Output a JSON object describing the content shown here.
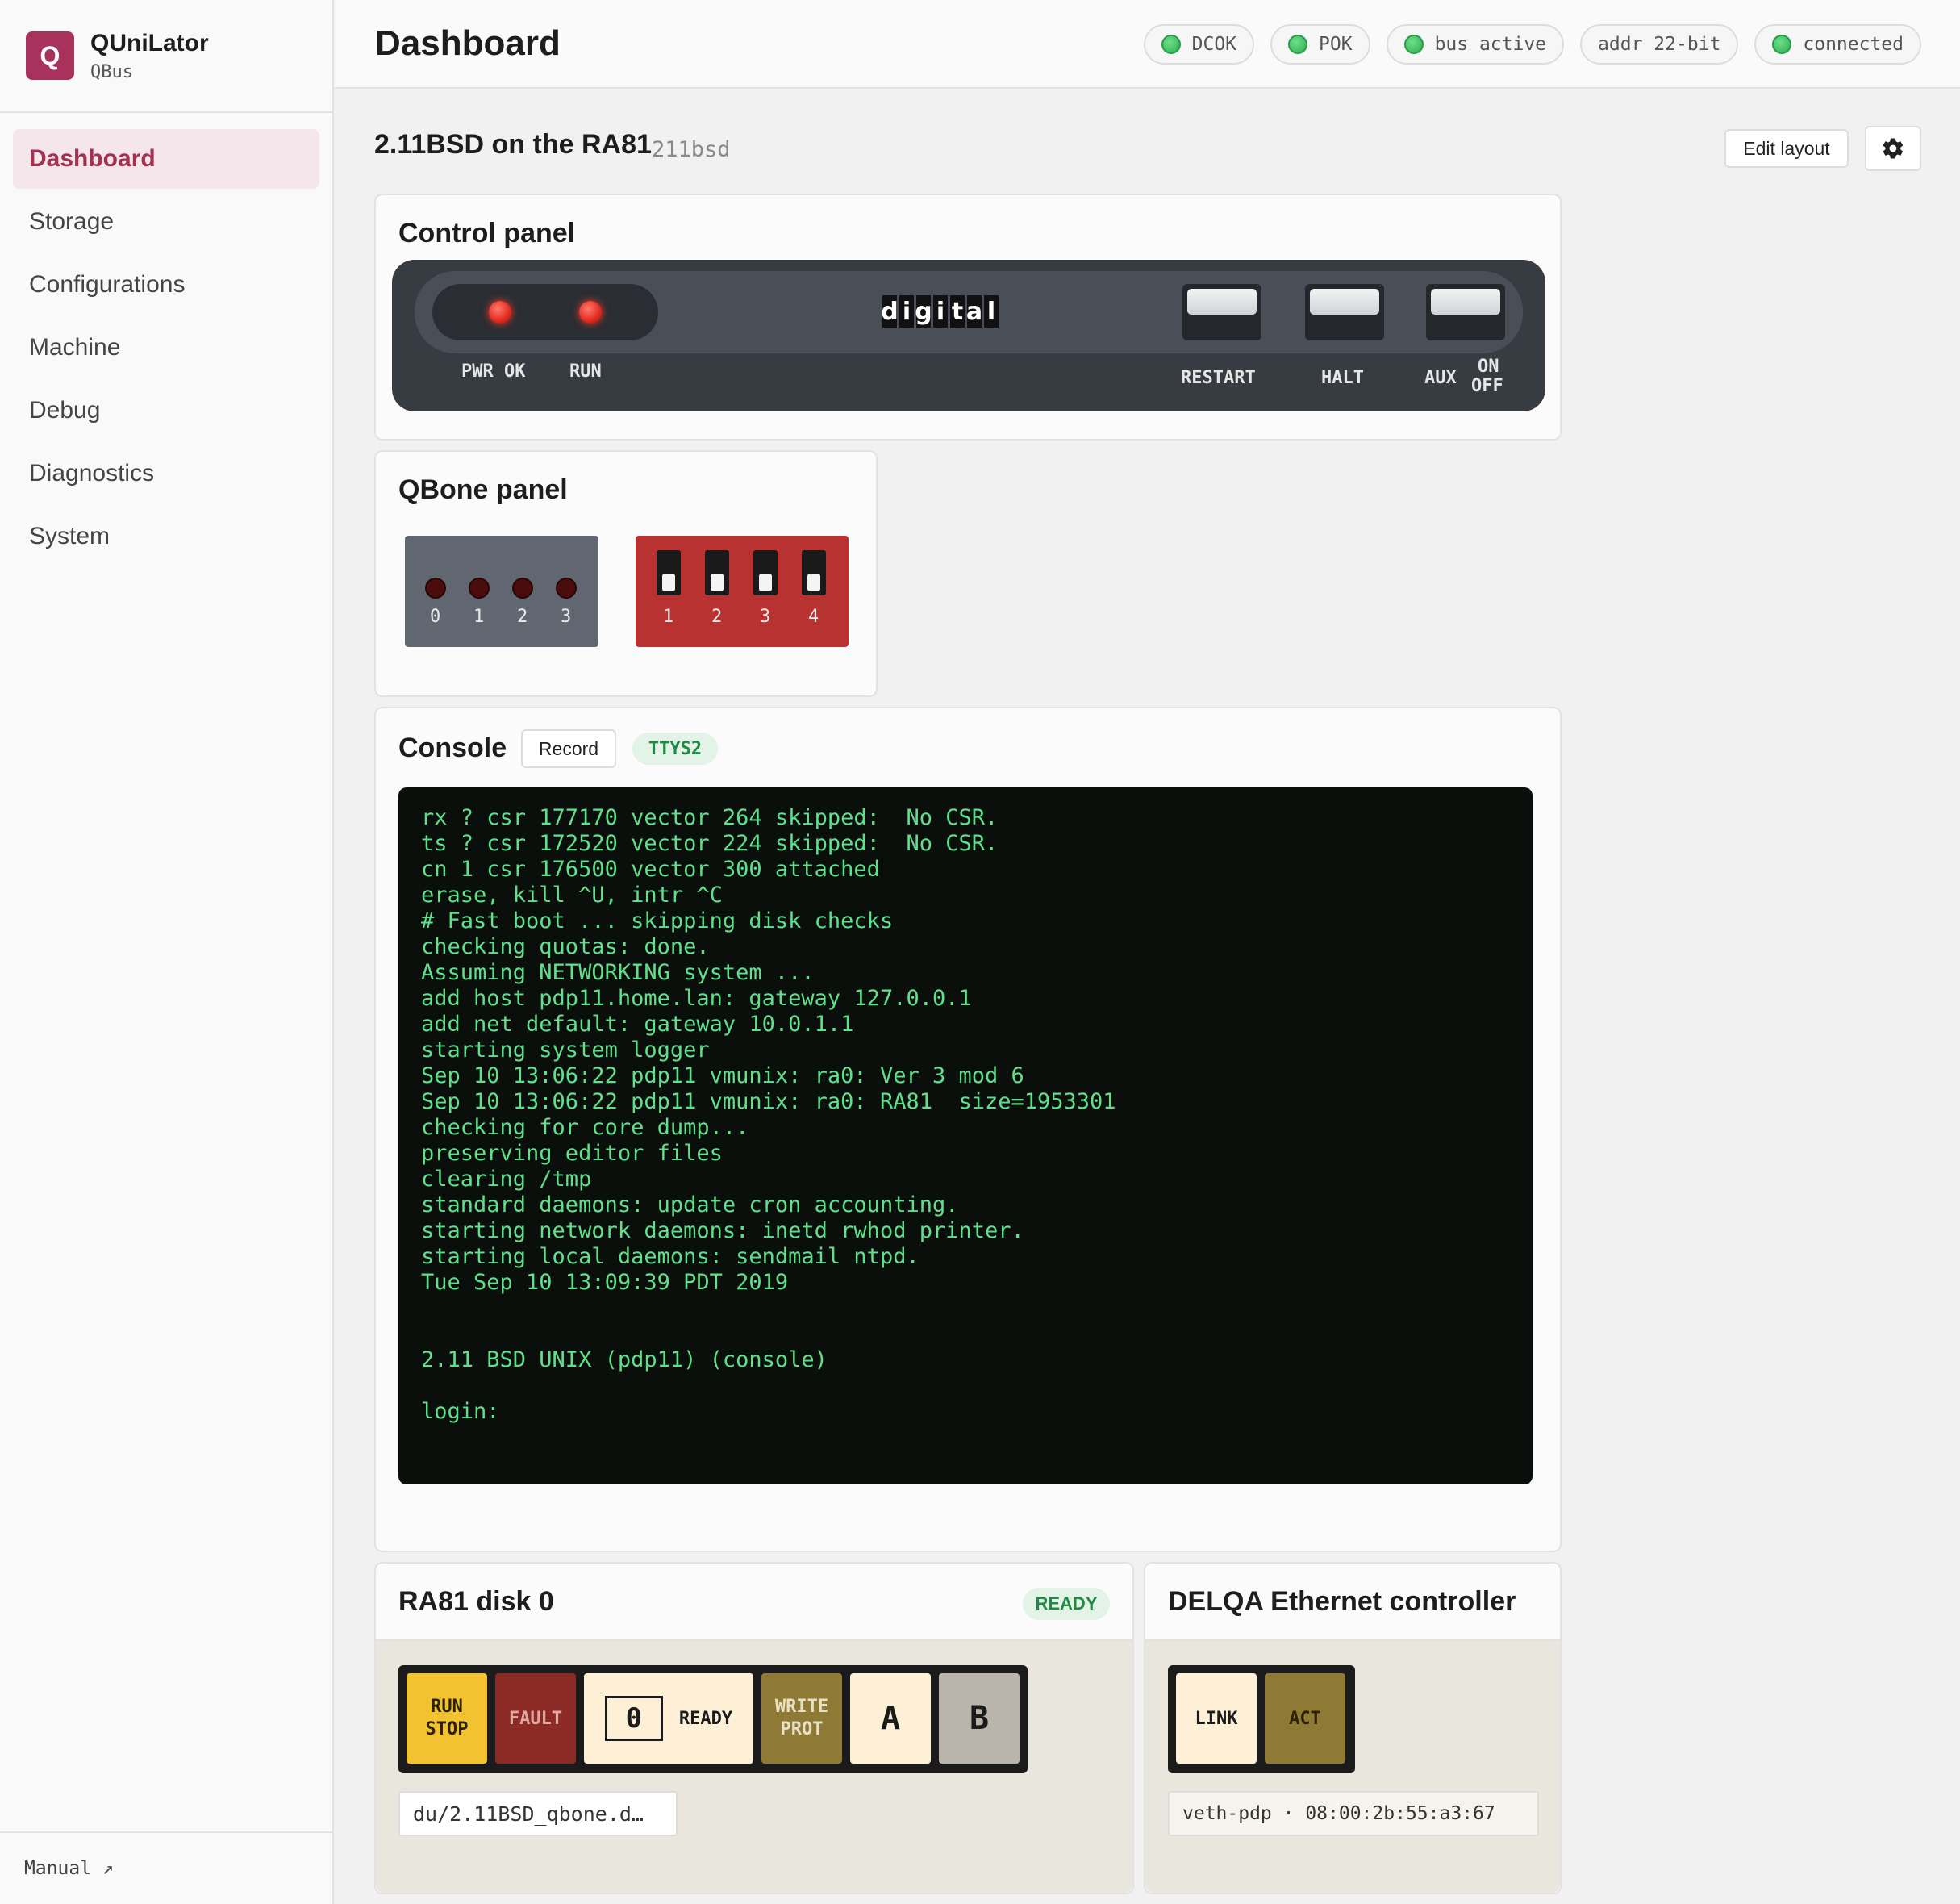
{
  "brand": {
    "logo": "Q",
    "name": "QUniLator",
    "sub": "QBus"
  },
  "nav": {
    "items": [
      {
        "label": "Dashboard"
      },
      {
        "label": "Storage"
      },
      {
        "label": "Configurations"
      },
      {
        "label": "Machine"
      },
      {
        "label": "Debug"
      },
      {
        "label": "Diagnostics"
      },
      {
        "label": "System"
      }
    ],
    "manual": "Manual ↗"
  },
  "header": {
    "title": "Dashboard",
    "status": [
      {
        "label": "DCOK",
        "led": true
      },
      {
        "label": "POK",
        "led": true
      },
      {
        "label": "bus active",
        "led": true
      },
      {
        "label": "addr 22-bit",
        "led": false
      },
      {
        "label": "connected",
        "led": true
      }
    ]
  },
  "machine": {
    "title": "2.11BSD on the RA81",
    "id": "211bsd",
    "edit_layout": "Edit layout",
    "settings_icon": "gear-icon"
  },
  "control_panel": {
    "title": "Control panel",
    "logo_letters": [
      "d",
      "i",
      "g",
      "i",
      "t",
      "a",
      "l"
    ],
    "leds": [
      {
        "label": "PWR OK",
        "state": "on",
        "color": "#e12a1e"
      },
      {
        "label": "RUN",
        "state": "on",
        "color": "#e12a1e"
      }
    ],
    "switches": [
      {
        "label": "RESTART"
      },
      {
        "label": "HALT"
      },
      {
        "label": "AUX"
      }
    ],
    "aux_on": "ON",
    "aux_off": "OFF"
  },
  "qbone": {
    "title": "QBone panel",
    "leds": [
      "0",
      "1",
      "2",
      "3"
    ],
    "dips": [
      "1",
      "2",
      "3",
      "4"
    ]
  },
  "console": {
    "title": "Console",
    "record": "Record",
    "tty": "TTYS2",
    "text": "rx ? csr 177170 vector 264 skipped:  No CSR.\nts ? csr 172520 vector 224 skipped:  No CSR.\ncn 1 csr 176500 vector 300 attached\nerase, kill ^U, intr ^C\n# Fast boot ... skipping disk checks\nchecking quotas: done.\nAssuming NETWORKING system ...\nadd host pdp11.home.lan: gateway 127.0.0.1\nadd net default: gateway 10.0.1.1\nstarting system logger\nSep 10 13:06:22 pdp11 vmunix: ra0: Ver 3 mod 6\nSep 10 13:06:22 pdp11 vmunix: ra0: RA81  size=1953301\nchecking for core dump...\npreserving editor files\nclearing /tmp\nstandard daemons: update cron accounting.\nstarting network daemons: inetd rwhod printer.\nstarting local daemons: sendmail ntpd.\nTue Sep 10 13:09:39 PDT 2019\n\n\n2.11 BSD UNIX (pdp11) (console)\n\nlogin: "
  },
  "disk": {
    "title": "RA81 disk 0",
    "status": "READY",
    "buttons": {
      "run_stop": "RUN\nSTOP",
      "fault": "FAULT",
      "unit": "0",
      "ready": "READY",
      "write_prot": "WRITE\nPROT",
      "a": "A",
      "b": "B"
    },
    "path": "du/2.11BSD_qbone.d…",
    "colors": {
      "run_stop": "#f2c230",
      "fault": "#8c2a26",
      "ready": "#fdf0d6",
      "write_prot": "#8f7a35",
      "a": "#fdf0d6",
      "b": "#b9b5ac"
    }
  },
  "ethernet": {
    "title": "DELQA Ethernet controller",
    "link": "LINK",
    "act": "ACT",
    "info": "veth-pdp · 08:00:2b:55:a3:67"
  }
}
